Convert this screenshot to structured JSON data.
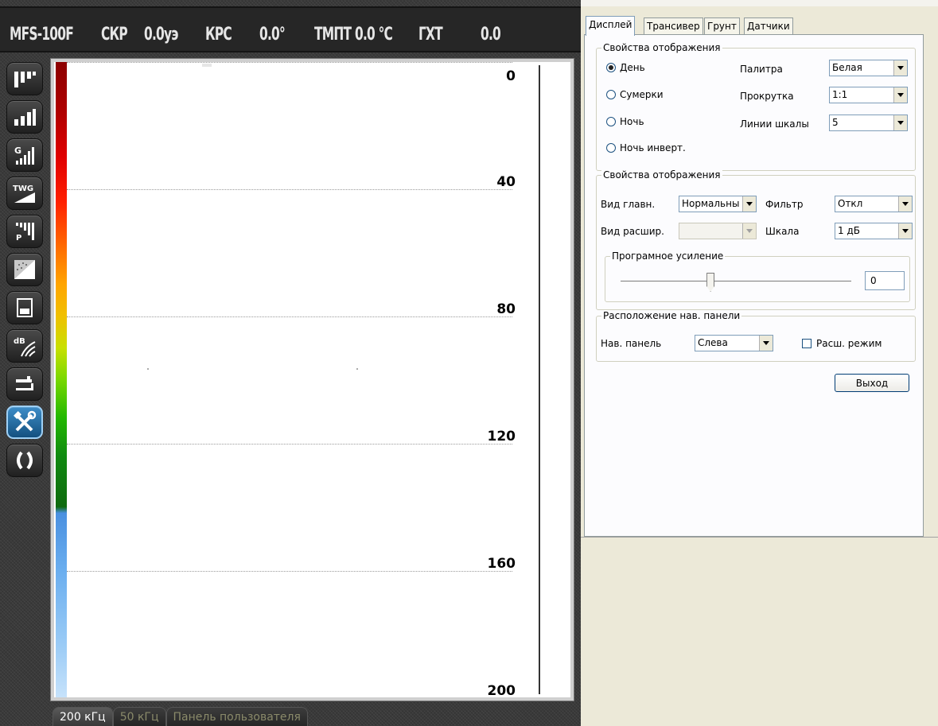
{
  "status_bar": {
    "model": "MFS-100F",
    "speed_label": "СКР",
    "speed_value": "0.0уэ",
    "course_label": "КРС",
    "course_value": "0.0°",
    "temp_label": "ТМПТ",
    "temp_value": "0.0 °С",
    "depth_label": "ГХТ",
    "depth_value": "0.0"
  },
  "nav_buttons": [
    {
      "name": "nav-mode-1-icon"
    },
    {
      "name": "nav-mode-2-icon"
    },
    {
      "name": "nav-gain-g-icon",
      "text": "G"
    },
    {
      "name": "nav-twg-icon",
      "text": "TWG"
    },
    {
      "name": "nav-power-p-icon",
      "text": "P"
    },
    {
      "name": "nav-bottom-texture-icon"
    },
    {
      "name": "nav-screen-icon"
    },
    {
      "name": "nav-db-signal-icon",
      "text": "dB"
    },
    {
      "name": "nav-transducer-icon"
    },
    {
      "name": "nav-settings-tools-icon"
    },
    {
      "name": "nav-brackets-icon"
    }
  ],
  "echogram": {
    "depth_labels": [
      "0",
      "40",
      "80",
      "120",
      "160",
      "200"
    ]
  },
  "freq_tabs": [
    {
      "label": "200 кГц",
      "active": true
    },
    {
      "label": "50 кГц",
      "active": false
    },
    {
      "label": "Панель пользователя",
      "active": false
    }
  ],
  "settings": {
    "tabs": [
      {
        "label": "Дисплей",
        "active": true
      },
      {
        "label": "Трансивер",
        "active": false
      },
      {
        "label": "Грунт",
        "active": false
      },
      {
        "label": "Датчики",
        "active": false
      }
    ],
    "display_group": {
      "title": "Свойства отображения",
      "modes": [
        {
          "label": "День",
          "selected": true
        },
        {
          "label": "Сумерки",
          "selected": false
        },
        {
          "label": "Ночь",
          "selected": false
        },
        {
          "label": "Ночь инверт.",
          "selected": false
        }
      ],
      "palette_label": "Палитра",
      "palette_value": "Белая",
      "scroll_label": "Прокрутка",
      "scroll_value": "1:1",
      "scale_lines_label": "Линии шкалы",
      "scale_lines_value": "5"
    },
    "view_group": {
      "title": "Свойства отображения",
      "main_view_label": "Вид главн.",
      "main_view_value": "Нормальны",
      "filter_label": "Фильтр",
      "filter_value": "Откл",
      "ext_view_label": "Вид расшир.",
      "ext_view_value": "",
      "scale_label": "Шкала",
      "scale_value": "1 дБ",
      "gain_group_title": "Програмное усиление",
      "gain_value": "0",
      "gain_level_fraction": 0.39
    },
    "nav_panel_group": {
      "title": "Расположение нав. панели",
      "nav_panel_label": "Нав. панель",
      "nav_panel_value": "Слева",
      "ext_mode_label": "Расш. режим",
      "ext_mode_checked": false
    },
    "exit_label": "Выход"
  }
}
